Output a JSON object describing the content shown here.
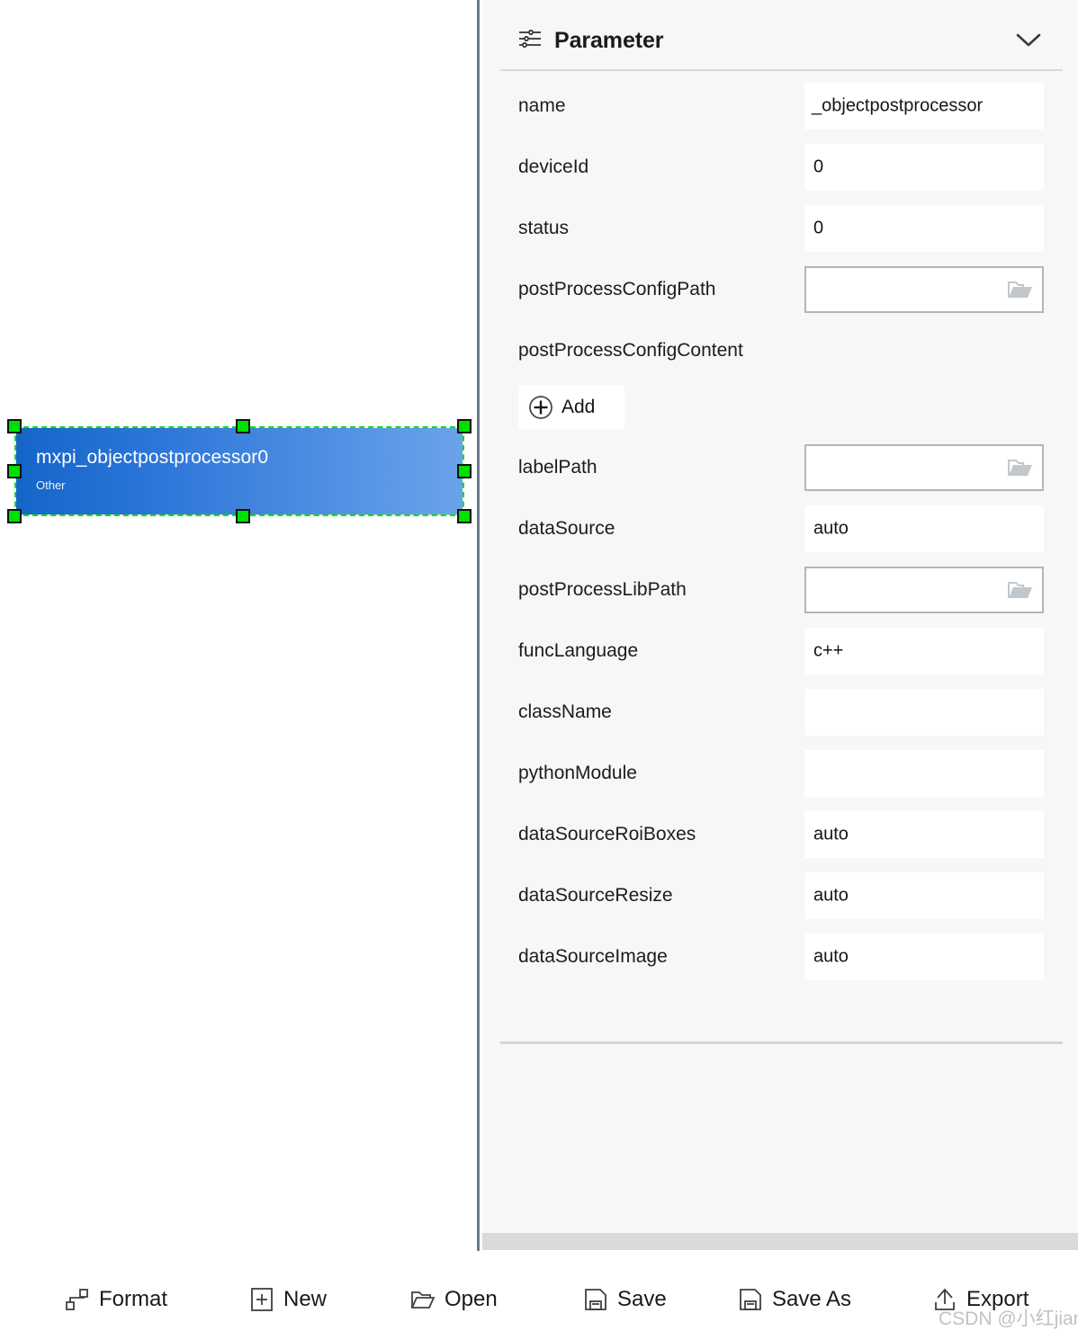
{
  "panel": {
    "title": "Parameter",
    "header_icon": "settings-sliders-icon",
    "collapse_icon": "chevron-down-icon",
    "add_button": {
      "label": "Add",
      "icon": "plus-circle-icon"
    },
    "rows": [
      {
        "label": "name",
        "value": "_objectpostprocessor",
        "kind": "text",
        "overflow": true
      },
      {
        "label": "deviceId",
        "value": "0",
        "kind": "text"
      },
      {
        "label": "status",
        "value": "0",
        "kind": "text"
      },
      {
        "label": "postProcessConfigPath",
        "value": "",
        "kind": "file"
      },
      {
        "label": "postProcessConfigContent",
        "value": "",
        "kind": "labelonly"
      },
      {
        "label": "labelPath",
        "value": "",
        "kind": "file"
      },
      {
        "label": "dataSource",
        "value": "auto",
        "kind": "text"
      },
      {
        "label": "postProcessLibPath",
        "value": "",
        "kind": "file"
      },
      {
        "label": "funcLanguage",
        "value": "c++",
        "kind": "text"
      },
      {
        "label": "className",
        "value": "",
        "kind": "text"
      },
      {
        "label": "pythonModule",
        "value": "",
        "kind": "text"
      },
      {
        "label": "dataSourceRoiBoxes",
        "value": "auto",
        "kind": "text"
      },
      {
        "label": "dataSourceResize",
        "value": "auto",
        "kind": "text"
      },
      {
        "label": "dataSourceImage",
        "value": "auto",
        "kind": "text"
      }
    ]
  },
  "canvas": {
    "node": {
      "title": "mxpi_objectpostprocessor0",
      "subtitle": "Other",
      "selected": true,
      "fill_start": "#1565c8",
      "fill_end": "#6ba3ea",
      "selection_color": "#00e000"
    }
  },
  "toolbar": {
    "items": [
      {
        "label": "Format",
        "icon": "format-nodes-icon"
      },
      {
        "label": "New",
        "icon": "plus-square-icon"
      },
      {
        "label": "Open",
        "icon": "folder-open-icon"
      },
      {
        "label": "Save",
        "icon": "floppy-disk-icon"
      },
      {
        "label": "Save As",
        "icon": "floppy-disk-icon"
      },
      {
        "label": "Export",
        "icon": "upload-arrow-icon"
      }
    ]
  },
  "watermark": {
    "text": "CSDN @小红jiang"
  }
}
